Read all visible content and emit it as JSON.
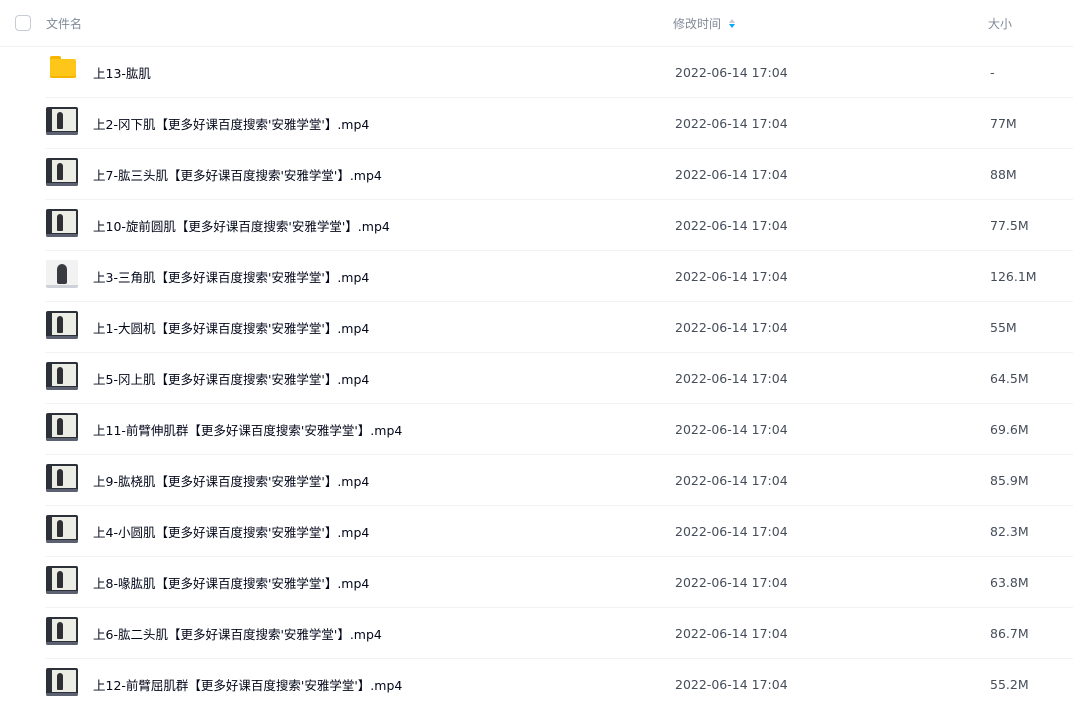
{
  "header": {
    "name_label": "文件名",
    "time_label": "修改时间",
    "size_label": "大小"
  },
  "colors": {
    "sort_active": "#06a7ff",
    "folder": "#ffc61a"
  },
  "files": [
    {
      "name": "上13-肱肌",
      "time": "2022-06-14 17:04",
      "size": "-",
      "icon": "folder-icon"
    },
    {
      "name": "上2-冈下肌【更多好课百度搜索'安雅学堂'】.mp4",
      "time": "2022-06-14 17:04",
      "size": "77M",
      "icon": "video-thumbnail"
    },
    {
      "name": "上7-肱三头肌【更多好课百度搜索'安雅学堂'】.mp4",
      "time": "2022-06-14 17:04",
      "size": "88M",
      "icon": "video-thumbnail"
    },
    {
      "name": "上10-旋前圆肌【更多好课百度搜索'安雅学堂'】.mp4",
      "time": "2022-06-14 17:04",
      "size": "77.5M",
      "icon": "video-thumbnail"
    },
    {
      "name": "上3-三角肌【更多好课百度搜索'安雅学堂'】.mp4",
      "time": "2022-06-14 17:04",
      "size": "126.1M",
      "icon": "video-thumbnail"
    },
    {
      "name": "上1-大圆机【更多好课百度搜索'安雅学堂'】.mp4",
      "time": "2022-06-14 17:04",
      "size": "55M",
      "icon": "video-thumbnail"
    },
    {
      "name": "上5-冈上肌【更多好课百度搜索'安雅学堂'】.mp4",
      "time": "2022-06-14 17:04",
      "size": "64.5M",
      "icon": "video-thumbnail"
    },
    {
      "name": "上11-前臂伸肌群【更多好课百度搜索'安雅学堂'】.mp4",
      "time": "2022-06-14 17:04",
      "size": "69.6M",
      "icon": "video-thumbnail"
    },
    {
      "name": "上9-肱桡肌【更多好课百度搜索'安雅学堂'】.mp4",
      "time": "2022-06-14 17:04",
      "size": "85.9M",
      "icon": "video-thumbnail"
    },
    {
      "name": "上4-小圆肌【更多好课百度搜索'安雅学堂'】.mp4",
      "time": "2022-06-14 17:04",
      "size": "82.3M",
      "icon": "video-thumbnail"
    },
    {
      "name": "上8-喙肱肌【更多好课百度搜索'安雅学堂'】.mp4",
      "time": "2022-06-14 17:04",
      "size": "63.8M",
      "icon": "video-thumbnail"
    },
    {
      "name": "上6-肱二头肌【更多好课百度搜索'安雅学堂'】.mp4",
      "time": "2022-06-14 17:04",
      "size": "86.7M",
      "icon": "video-thumbnail"
    },
    {
      "name": "上12-前臂屈肌群【更多好课百度搜索'安雅学堂'】.mp4",
      "time": "2022-06-14 17:04",
      "size": "55.2M",
      "icon": "video-thumbnail"
    }
  ]
}
